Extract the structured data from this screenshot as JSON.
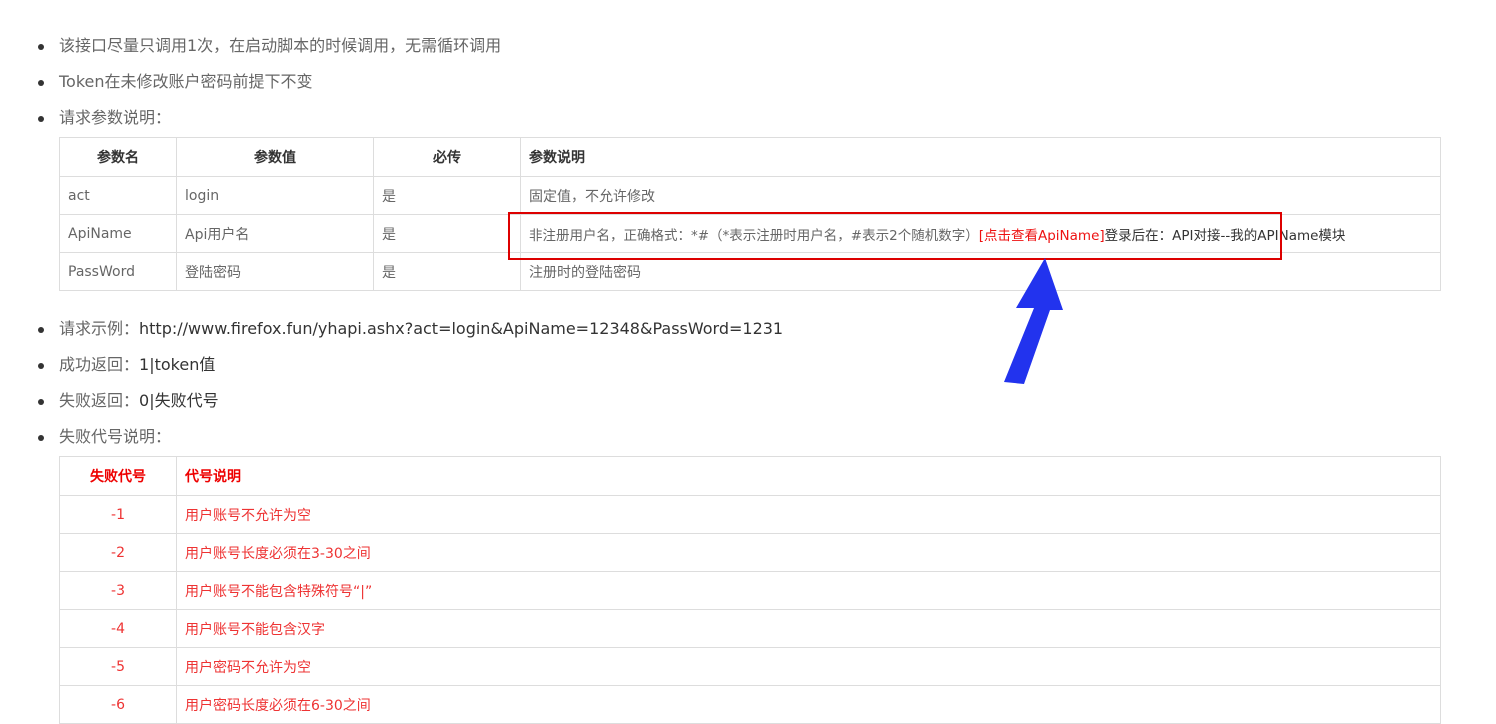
{
  "bullets": [
    {
      "text": "该接口尽量只调用1次，在启动脚本的时候调用，无需循环调用"
    },
    {
      "text": "Token在未修改账户密码前提下不变"
    },
    {
      "text": "请求参数说明："
    }
  ],
  "param_table": {
    "headers": [
      "参数名",
      "参数值",
      "必传",
      "参数说明"
    ],
    "rows": [
      {
        "name": "act",
        "value": "login",
        "required": "是",
        "desc": "固定值，不允许修改"
      },
      {
        "name": "ApiName",
        "value": "Api用户名",
        "required": "是",
        "desc_before": "非注册用户名，正确格式：*#（*表示注册时用户名，#表示2个随机数字）",
        "desc_link": "[点击查看ApiName]",
        "desc_after": "登录后在：API对接--我的APIName模块"
      },
      {
        "name": "PassWord",
        "value": "登陆密码",
        "required": "是",
        "desc": "注册时的登陆密码"
      }
    ]
  },
  "bullets2": [
    {
      "label": "请求示例：",
      "value": "http://www.firefox.fun/yhapi.ashx?act=login&ApiName=12348&PassWord=1231"
    },
    {
      "label": "成功返回：",
      "value": "1|token值"
    },
    {
      "label": "失败返回：",
      "value": "0|失败代号"
    },
    {
      "label": "失败代号说明：",
      "value": ""
    }
  ],
  "error_table": {
    "headers": [
      "失败代号",
      "代号说明"
    ],
    "rows": [
      {
        "code": "-1",
        "desc": "用户账号不允许为空"
      },
      {
        "code": "-2",
        "desc": "用户账号长度必须在3-30之间"
      },
      {
        "code": "-3",
        "desc": "用户账号不能包含特殊符号“|”"
      },
      {
        "code": "-4",
        "desc": "用户账号不能包含汉字"
      },
      {
        "code": "-5",
        "desc": "用户密码不允许为空"
      },
      {
        "code": "-6",
        "desc": "用户密码长度必须在6-30之间"
      }
    ]
  },
  "colors": {
    "highlight_box": "#dd0000",
    "arrow": "#2233ee",
    "error_text": "#ee3333"
  }
}
